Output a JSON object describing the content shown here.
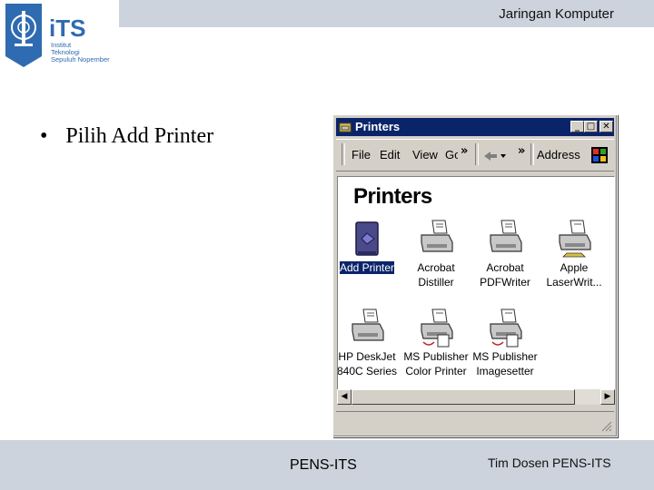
{
  "header": {
    "course_title": "Jaringan Komputer",
    "logo": {
      "abbr": "iTS",
      "line1": "Institut",
      "line2": "Teknologi",
      "line3": "Sepuluh Nopember"
    }
  },
  "slide": {
    "bullet": "Pilih Add Printer"
  },
  "window": {
    "title": "Printers",
    "controls": {
      "minimize": "_",
      "maximize": "□",
      "close": "✕"
    },
    "menu": [
      {
        "label": "File"
      },
      {
        "label": "Edit"
      },
      {
        "label": "View"
      },
      {
        "label": "Go"
      }
    ],
    "chevron": "»",
    "address_label": "Address",
    "folder_title": "Printers",
    "items": [
      {
        "label": "Add Printer",
        "icon": "add-printer-icon",
        "selected": true
      },
      {
        "label": "Acrobat\nDistiller",
        "icon": "printer-icon"
      },
      {
        "label": "Acrobat\nPDFWriter",
        "icon": "printer-icon"
      },
      {
        "label": "Apple\nLaserWrit...",
        "icon": "network-printer-icon"
      },
      {
        "label": "HP DeskJet\n840C Series",
        "icon": "printer-icon"
      },
      {
        "label": "MS Publisher\nColor Printer",
        "icon": "file-printer-icon"
      },
      {
        "label": "MS Publisher\nImagesetter",
        "icon": "file-printer-icon"
      }
    ]
  },
  "footer": {
    "center": "PENS-ITS",
    "right": "Tim Dosen PENS-ITS"
  },
  "colors": {
    "band": "#ccd3dd",
    "titlebar": "#0a246a",
    "window_face": "#d4d0c8",
    "logo_blue": "#2f6bb0"
  }
}
